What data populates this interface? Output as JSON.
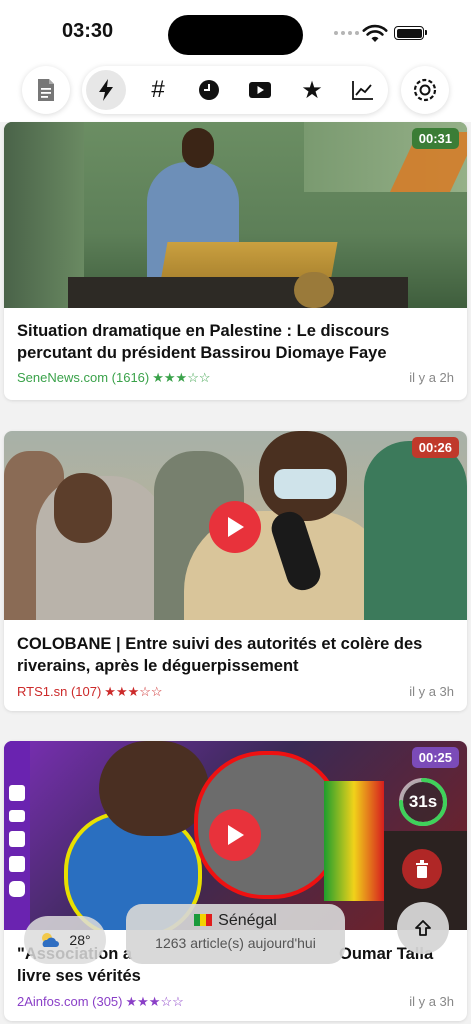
{
  "status_bar": {
    "time": "03:30"
  },
  "toolbar": {
    "left_icon": "document-icon",
    "tabs": [
      {
        "name": "flash-icon",
        "active": true
      },
      {
        "name": "hashtag-icon",
        "active": false
      },
      {
        "name": "clock-icon",
        "active": false
      },
      {
        "name": "video-icon",
        "active": false
      },
      {
        "name": "star-icon",
        "active": false
      },
      {
        "name": "chart-icon",
        "active": false
      }
    ],
    "right_icon": "settings-icon"
  },
  "articles": [
    {
      "duration": "00:31",
      "duration_color": "#3b7d36",
      "title": "Situation dramatique en Palestine : Le discours percutant du président Bassirou Diomaye Faye",
      "source": "SeneNews.com (1616)",
      "source_color": "#3aa24a",
      "rating": 3,
      "stars": "★★★☆☆",
      "time_ago": "il y a 2h",
      "has_play": false
    },
    {
      "duration": "00:26",
      "duration_color": "#c0392b",
      "title": "COLOBANE | Entre suivi des autorités et colère des riverains, après le déguerpissement",
      "source": "RTS1.sn (107)",
      "source_color": "#cc2a2a",
      "rating": 3,
      "stars": "★★★☆☆",
      "time_ago": "il y a 3h",
      "has_play": true
    },
    {
      "duration": "00:25",
      "duration_color": "#7b4bb8",
      "title_left": "\"Association a",
      "title_right": "Oumar Talla",
      "title_line2": "livre ses vérités",
      "source": "2Ainfos.com (305)",
      "source_color": "#8a3fc7",
      "rating": 3,
      "stars": "★★★☆☆",
      "time_ago": "il y a 3h",
      "has_play": true,
      "countdown": "31s",
      "countdown_progress": 0.75
    }
  ],
  "floating": {
    "weather_temp": "28°",
    "weather_icon": "partly-cloudy-icon",
    "country": "Sénégal",
    "country_flag": "senegal-flag-icon",
    "article_count": "1263 article(s) aujourd'hui",
    "scroll_top_icon": "arrow-up-icon"
  }
}
